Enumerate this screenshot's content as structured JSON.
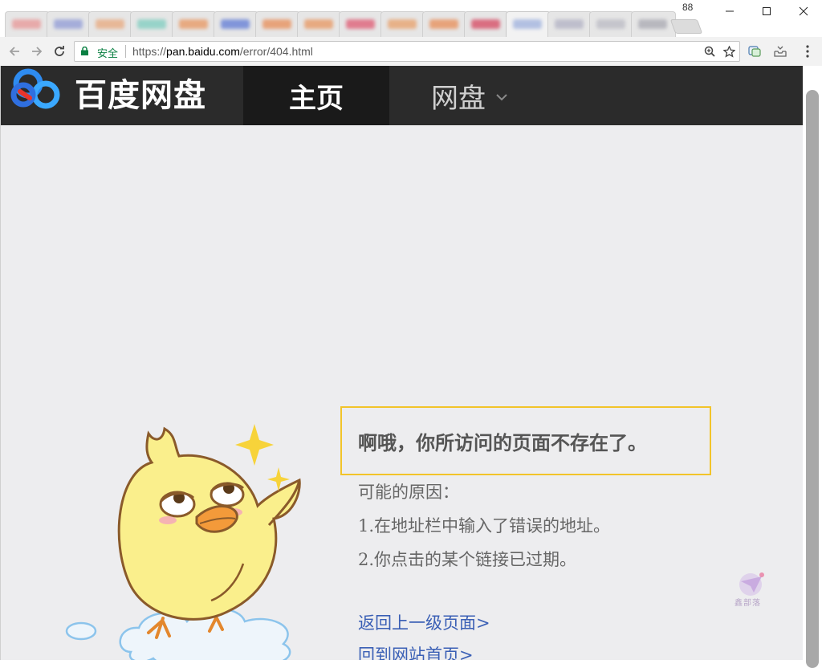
{
  "browser": {
    "tab_count": "88",
    "secure_label": "安全",
    "url_scheme": "https://",
    "url_host": "pan.baidu.com",
    "url_path": "/error/404.html",
    "window_controls": [
      "minimize",
      "maximize",
      "close"
    ]
  },
  "site": {
    "logo_text": "百度网盘",
    "nav_home": "主页",
    "nav_disk": "网盘"
  },
  "error": {
    "title": "啊哦，你所访问的页面不存在了。",
    "reasons_heading": "可能的原因：",
    "reason_1": "1.在地址栏中输入了错误的地址。",
    "reason_2": "2.你点击的某个链接已过期。",
    "link_back": "返回上一级页面>",
    "link_home": "回到网站首页>"
  },
  "watermark": {
    "text": "鑫部落"
  },
  "colors": {
    "header_bg": "#2b2b2b",
    "active_nav_bg": "#1a1a1a",
    "page_bg": "#ededef",
    "highlight_border": "#f2c42a",
    "link": "#3a5fb5",
    "secure": "#0b8043"
  }
}
